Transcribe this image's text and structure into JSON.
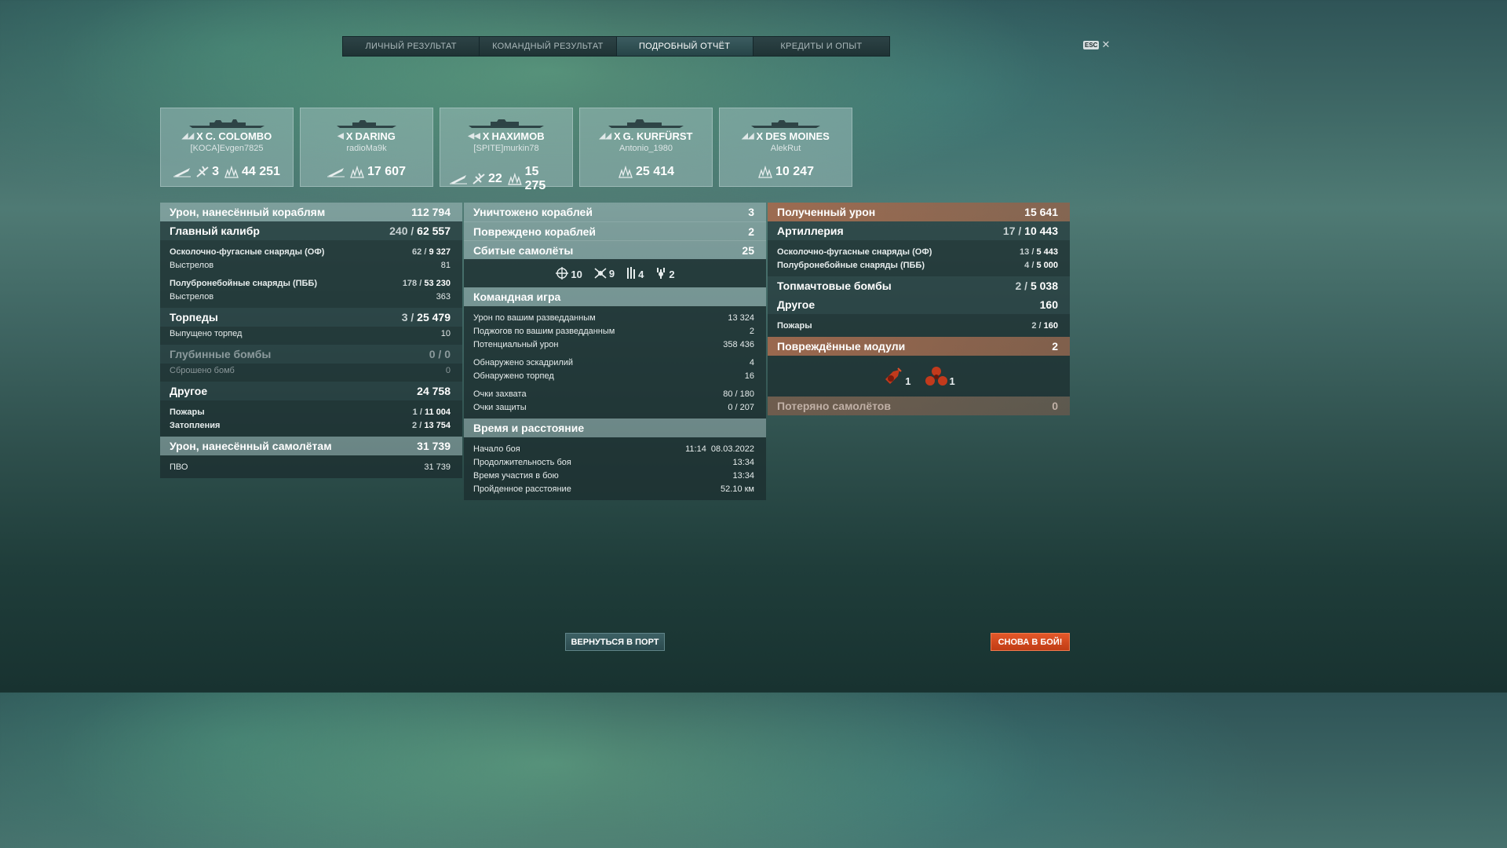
{
  "tabs": [
    {
      "label": "ЛИЧНЫЙ РЕЗУЛЬТАТ"
    },
    {
      "label": "КОМАНДНЫЙ РЕЗУЛЬТАТ"
    },
    {
      "label": "ПОДРОБНЫЙ ОТЧЁТ",
      "active": true
    },
    {
      "label": "КРЕДИТЫ И ОПЫТ"
    }
  ],
  "esc": {
    "key": "ESC",
    "close": "✕"
  },
  "cards": [
    {
      "tier": "X",
      "ship": "C. COLOMBO",
      "player": "[KOCA]Evgen7825",
      "stats": {
        "destroyed": "3",
        "damage": "44 251"
      }
    },
    {
      "tier": "X",
      "ship": "DARING",
      "player": "radioMa9k",
      "stats": {
        "damage": "17 607"
      }
    },
    {
      "tier": "X",
      "ship": "НАХИМОВ",
      "player": "[SPITE]murkin78",
      "stats": {
        "destroyed": "22",
        "damage": "15 275"
      }
    },
    {
      "tier": "X",
      "ship": "G. KURFÜRST",
      "player": "Antonio_1980",
      "stats": {
        "damage": "25 414"
      }
    },
    {
      "tier": "X",
      "ship": "DES MOINES",
      "player": "AlekRut",
      "stats": {
        "damage": "10 247"
      }
    }
  ],
  "left": {
    "ship_damage": {
      "label": "Урон, нанесённый кораблям",
      "value": "112 794"
    },
    "main_caliber": {
      "label": "Главный калибр",
      "hits": "240",
      "dmg": "62 557"
    },
    "he": {
      "label": "Осколочно-фугасные снаряды (ОФ)",
      "hits": "62",
      "dmg": "9 327"
    },
    "he_shots": {
      "label": "Выстрелов",
      "value": "81"
    },
    "ap": {
      "label": "Полубронебойные снаряды (ПББ)",
      "hits": "178",
      "dmg": "53 230"
    },
    "ap_shots": {
      "label": "Выстрелов",
      "value": "363"
    },
    "torpedoes": {
      "label": "Торпеды",
      "hits": "3",
      "dmg": "25 479"
    },
    "torps_launched": {
      "label": "Выпущено торпед",
      "value": "10"
    },
    "depth": {
      "label": "Глубинные бомбы",
      "hits": "0",
      "dmg": "0"
    },
    "depth_dropped": {
      "label": "Сброшено бомб",
      "value": "0"
    },
    "other": {
      "label": "Другое",
      "value": "24 758"
    },
    "fires": {
      "label": "Пожары",
      "hits": "1",
      "dmg": "11 004"
    },
    "floods": {
      "label": "Затопления",
      "hits": "2",
      "dmg": "13 754"
    },
    "plane_damage": {
      "label": "Урон, нанесённый самолётам",
      "value": "31 739"
    },
    "aa": {
      "label": "ПВО",
      "value": "31 739"
    }
  },
  "middle": {
    "destroyed": {
      "label": "Уничтожено кораблей",
      "value": "3"
    },
    "damaged": {
      "label": "Повреждено кораблей",
      "value": "2"
    },
    "planes": {
      "label": "Сбитые самолёты",
      "value": "25"
    },
    "plane_types": [
      {
        "icon": "fighter-icon",
        "value": "10"
      },
      {
        "icon": "attack-aircraft-icon",
        "value": "9"
      },
      {
        "icon": "torpedo-bomber-icon",
        "value": "4"
      },
      {
        "icon": "dive-bomber-icon",
        "value": "2"
      }
    ],
    "team": {
      "title": "Командная игра",
      "spotting_damage": {
        "label": "Урон по вашим разведданным",
        "value": "13 324"
      },
      "spotting_fires": {
        "label": "Поджогов по вашим разведданным",
        "value": "2"
      },
      "potential": {
        "label": "Потенциальный урон",
        "value": "358 436"
      },
      "squadrons": {
        "label": "Обнаружено эскадрилий",
        "value": "4"
      },
      "torps_spotted": {
        "label": "Обнаружено торпед",
        "value": "16"
      },
      "capture": {
        "label": "Очки захвата",
        "a": "80",
        "b": "180"
      },
      "defense": {
        "label": "Очки защиты",
        "a": "0",
        "b": "207"
      }
    },
    "time": {
      "title": "Время и расстояние",
      "start": {
        "label": "Начало боя",
        "value": "11:14  08.03.2022"
      },
      "duration": {
        "label": "Продолжительность боя",
        "value": "13:34"
      },
      "participation": {
        "label": "Время участия в бою",
        "value": "13:34"
      },
      "distance": {
        "label": "Пройденное расстояние",
        "value": "52.10 км"
      }
    }
  },
  "right": {
    "received": {
      "label": "Полученный урон",
      "value": "15 641"
    },
    "artillery": {
      "label": "Артиллерия",
      "hits": "17",
      "dmg": "10 443"
    },
    "he": {
      "label": "Осколочно-фугасные снаряды (ОФ)",
      "hits": "13",
      "dmg": "5 443"
    },
    "ap": {
      "label": "Полубронебойные снаряды (ПББ)",
      "hits": "4",
      "dmg": "5 000"
    },
    "skip": {
      "label": "Топмачтовые бомбы",
      "hits": "2",
      "dmg": "5 038"
    },
    "other": {
      "label": "Другое",
      "value": "160"
    },
    "fires": {
      "label": "Пожары",
      "hits": "2",
      "dmg": "160"
    },
    "modules": {
      "label": "Повреждённые модули",
      "value": "2"
    },
    "module_items": [
      {
        "icon": "engine-icon",
        "value": "1"
      },
      {
        "icon": "propeller-icon",
        "value": "1"
      }
    ],
    "planes_lost": {
      "label": "Потеряно самолётов",
      "value": "0"
    }
  },
  "buttons": {
    "port": "ВЕРНУТЬСЯ В ПОРТ",
    "battle": "СНОВА В БОЙ!"
  },
  "colors": {
    "accent_orange": "#d9491d",
    "damage_received": "#a8694b"
  }
}
